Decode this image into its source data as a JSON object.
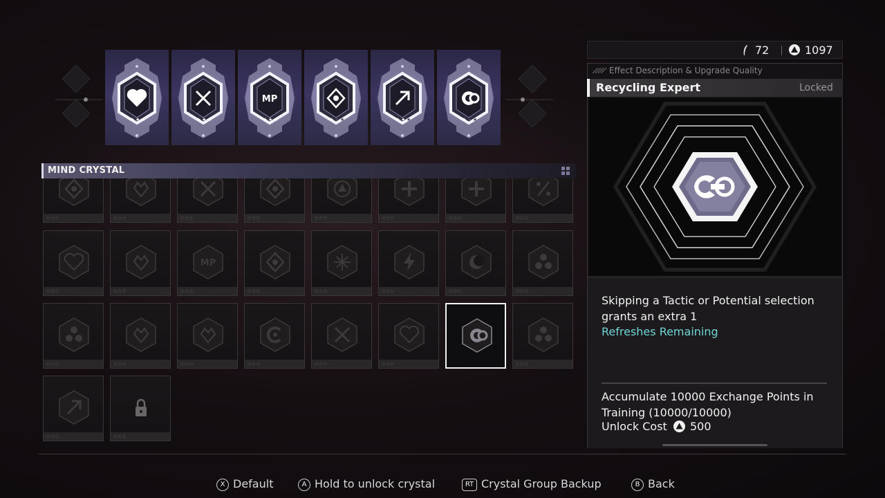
{
  "currency": {
    "energy_icon": "feather-icon",
    "energy_value": "72",
    "exchange_icon": "triangle-coin-icon",
    "exchange_value": "1097"
  },
  "equipped": [
    {
      "icon": "heart-icon",
      "stars": 3
    },
    {
      "icon": "crossed-swords-icon",
      "stars": 3
    },
    {
      "icon": "mp-icon",
      "stars": 3
    },
    {
      "icon": "diamond-heart-icon",
      "stars": 1
    },
    {
      "icon": "arrow-up-right-icon",
      "stars": 2
    },
    {
      "icon": "cycle-icon",
      "stars": 1
    }
  ],
  "mind_crystal": {
    "title": "MIND CRYSTAL",
    "grid": [
      [
        "diamond-pattern",
        "leaf",
        "cross-x",
        "diamond-heart",
        "triangle-circle",
        "plus",
        "plus-circle",
        "percent"
      ],
      [
        "heart-split",
        "heart-wings",
        "mp",
        "diamond-circle",
        "sparkle",
        "bolt",
        "crescent",
        "trefoil"
      ],
      [
        "radiation",
        "shield-heart",
        "crown-heart",
        "c-ring",
        "x-heart",
        "heart-outline",
        "recycling",
        "triple-circle"
      ],
      [
        "arrow-slash",
        "locked"
      ]
    ],
    "selected": "recycling"
  },
  "panel": {
    "subtitle": "Effect Description & Upgrade Quality",
    "name": "Recycling Expert",
    "status": "Locked",
    "description": "Skipping a Tactic or Potential selection grants an extra 1",
    "description_highlight": "Refreshes Remaining",
    "unlock_condition": "Accumulate 10000 Exchange Points in Training (10000/10000)",
    "unlock_cost_label": "Unlock Cost",
    "unlock_cost_value": "500"
  },
  "hints": {
    "default": {
      "button": "X",
      "label": "Default"
    },
    "unlock": {
      "button": "A",
      "label": "Hold to unlock crystal"
    },
    "backup": {
      "button": "RT",
      "label": "Crystal Group Backup"
    },
    "back": {
      "button": "B",
      "label": "Back"
    }
  },
  "colors": {
    "accent_cyan": "#6fd6d6",
    "equip_slot_bg": "#3b3560",
    "selected_border": "#f4f4f4"
  }
}
